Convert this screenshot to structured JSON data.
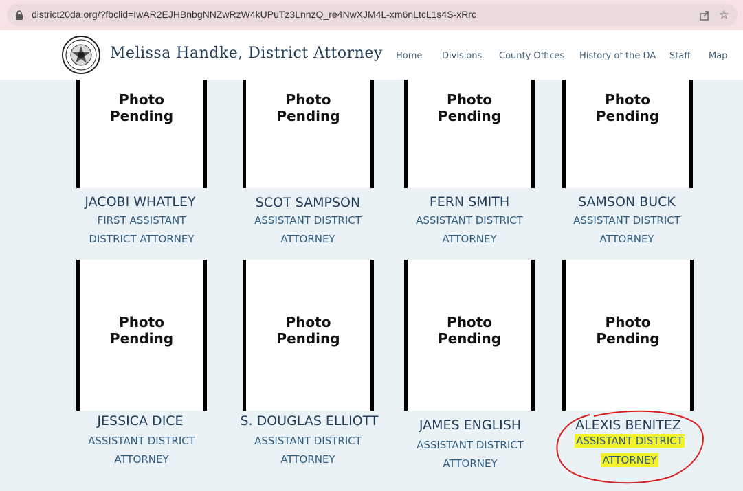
{
  "browser": {
    "url": "district20da.org/?fbclid=IwAR2EJHBnbgNNZwRzW4kUPuTz3LnnzQ_re4NwXJM4L-xm6nLtcL1s4S-xRrc"
  },
  "header": {
    "site_title": "Melissa Handke, District Attorney",
    "nav": [
      "Home",
      "Divisions",
      "County Offices",
      "History of the DA",
      "Staff",
      "Map"
    ]
  },
  "photo_placeholder": {
    "line1": "Photo",
    "line2": "Pending"
  },
  "staff": [
    {
      "name": "JACOBI WHATLEY",
      "title1": "FIRST ASSISTANT",
      "title2": "DISTRICT ATTORNEY"
    },
    {
      "name": "SCOT SAMPSON",
      "title1": "ASSISTANT DISTRICT",
      "title2": "ATTORNEY"
    },
    {
      "name": "FERN SMITH",
      "title1": "ASSISTANT DISTRICT",
      "title2": "ATTORNEY"
    },
    {
      "name": "SAMSON BUCK",
      "title1": "ASSISTANT DISTRICT",
      "title2": "ATTORNEY"
    },
    {
      "name": "JESSICA DICE",
      "title1": "ASSISTANT DISTRICT",
      "title2": "ATTORNEY"
    },
    {
      "name": "S. DOUGLAS ELLIOTT",
      "title1": "ASSISTANT DISTRICT",
      "title2": "ATTORNEY"
    },
    {
      "name": "JAMES ENGLISH",
      "title1": "ASSISTANT DISTRICT",
      "title2": "ATTORNEY"
    },
    {
      "name": "ALEXIS BENITEZ",
      "title1": "ASSISTANT DISTRICT",
      "title2": "ATTORNEY"
    }
  ],
  "colors": {
    "highlight": "#f4f22a",
    "annotation": "#d61f1f",
    "name_text": "#1f3b57",
    "title_text": "#2f5d82"
  }
}
